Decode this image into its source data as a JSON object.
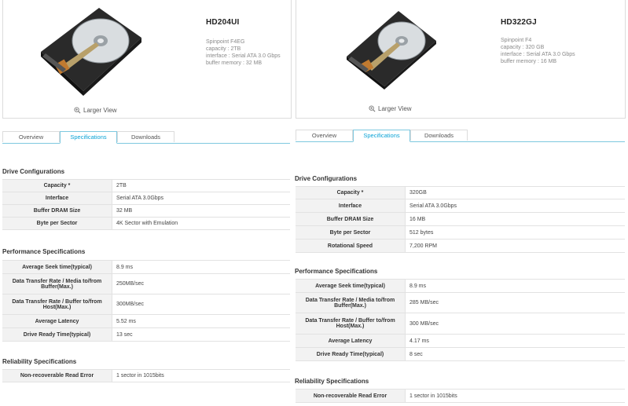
{
  "left": {
    "model": "HD204UI",
    "spec_lines": [
      "Spinpoint F4EG",
      "capacity : 2TB",
      "interface : Serial ATA 3.0 Gbps",
      "buffer memory : 32 MB"
    ],
    "larger_view": "Larger View",
    "tabs": [
      {
        "label": "Overview"
      },
      {
        "label": "Specifications",
        "active": true
      },
      {
        "label": "Downloads"
      }
    ],
    "drive_config": {
      "title": "Drive Configurations",
      "rows": [
        {
          "k": "Capacity *",
          "v": "2TB"
        },
        {
          "k": "Interface",
          "v": "Serial ATA 3.0Gbps"
        },
        {
          "k": "Buffer DRAM Size",
          "v": "32 MB"
        },
        {
          "k": "Byte per Sector",
          "v": "4K Sector with Emulation"
        }
      ]
    },
    "performance": {
      "title": "Performance Specifications",
      "rows": [
        {
          "k": "Average Seek time(typical)",
          "v": "8.9 ms"
        },
        {
          "k": "Data Transfer Rate / Media to/from Buffer(Max.)",
          "v": "250MB/sec"
        },
        {
          "k": "Data Transfer Rate / Buffer to/from Host(Max.)",
          "v": "300MB/sec"
        },
        {
          "k": "Average Latency",
          "v": "5.52 ms"
        },
        {
          "k": "Drive Ready Time(typical)",
          "v": "13 sec"
        }
      ]
    },
    "reliability": {
      "title": "Reliability Specifications",
      "rows": [
        {
          "k": "Non-recoverable Read Error",
          "v": "1 sector in 1015bits"
        }
      ]
    }
  },
  "right": {
    "model": "HD322GJ",
    "spec_lines": [
      "Spinpoint F4",
      "capacity : 320 GB",
      "interface : Serial ATA 3.0 Gbps",
      "buffer memory : 16 MB"
    ],
    "larger_view": "Larger View",
    "tabs": [
      {
        "label": "Overview"
      },
      {
        "label": "Specifications",
        "active": true
      },
      {
        "label": "Downloads"
      }
    ],
    "drive_config": {
      "title": "Drive Configurations",
      "rows": [
        {
          "k": "Capacity *",
          "v": "320GB"
        },
        {
          "k": "Interface",
          "v": "Serial ATA 3.0Gbps"
        },
        {
          "k": "Buffer DRAM Size",
          "v": "16 MB"
        },
        {
          "k": "Byte per Sector",
          "v": "512 bytes"
        },
        {
          "k": "Rotational Speed",
          "v": "7,200 RPM"
        }
      ]
    },
    "performance": {
      "title": "Performance Specifications",
      "rows": [
        {
          "k": "Average Seek time(typical)",
          "v": "8.9 ms"
        },
        {
          "k": "Data Transfer Rate / Media to/from Buffer(Max.)",
          "v": "285 MB/sec"
        },
        {
          "k": "Data Transfer Rate / Buffer to/from Host(Max.)",
          "v": "300 MB/sec"
        },
        {
          "k": "Average Latency",
          "v": "4.17 ms"
        },
        {
          "k": "Drive Ready Time(typical)",
          "v": "8 sec"
        }
      ]
    },
    "reliability": {
      "title": "Reliability Specifications",
      "rows": [
        {
          "k": "Non-recoverable Read Error",
          "v": "1 sector in 1015bits"
        }
      ]
    }
  }
}
